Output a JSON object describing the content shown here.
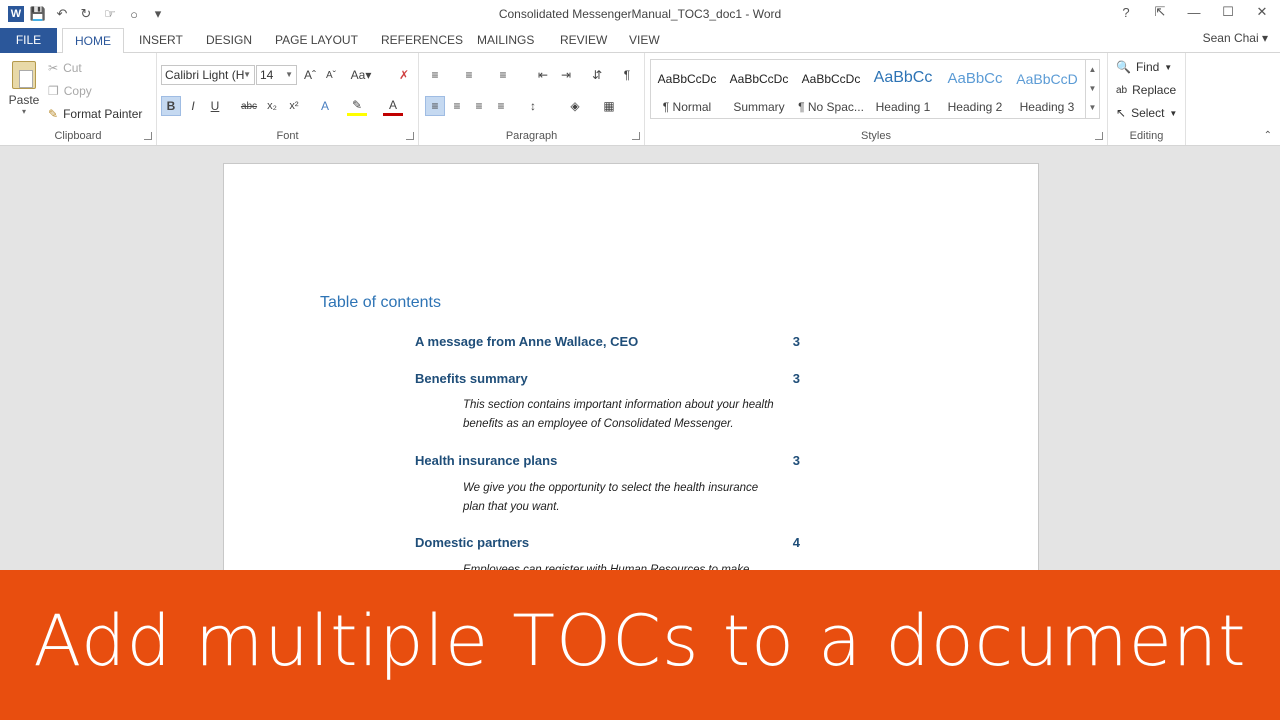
{
  "window": {
    "title": "Consolidated MessengerManual_TOC3_doc1 - Word",
    "help": "?",
    "user": "Sean Chai"
  },
  "tabs": [
    "FILE",
    "HOME",
    "INSERT",
    "DESIGN",
    "PAGE LAYOUT",
    "REFERENCES",
    "MAILINGS",
    "REVIEW",
    "VIEW"
  ],
  "clipboard": {
    "paste": "Paste",
    "cut": "Cut",
    "copy": "Copy",
    "format_painter": "Format Painter",
    "label": "Clipboard"
  },
  "font": {
    "name": "Calibri Light (H",
    "size": "14",
    "label": "Font"
  },
  "paragraph": {
    "label": "Paragraph"
  },
  "styles": {
    "label": "Styles",
    "items": [
      {
        "sample": "AaBbCcDc",
        "name": "¶ Normal"
      },
      {
        "sample": "AaBbCcDc",
        "name": "Summary"
      },
      {
        "sample": "AaBbCcDc",
        "name": "¶ No Spac..."
      },
      {
        "sample": "AaBbCc",
        "name": "Heading 1"
      },
      {
        "sample": "AaBbCc",
        "name": "Heading 2"
      },
      {
        "sample": "AaBbCcD",
        "name": "Heading 3"
      }
    ]
  },
  "editing": {
    "find": "Find",
    "replace": "Replace",
    "select": "Select",
    "label": "Editing"
  },
  "document": {
    "toc_title": "Table of contents",
    "entries": [
      {
        "title": "A message from Anne Wallace, CEO",
        "page": "3"
      },
      {
        "title": "Benefits summary",
        "page": "3",
        "desc1": "This section contains important information about your health",
        "desc2": "benefits as an employee of Consolidated Messenger."
      },
      {
        "title": "Health insurance plans",
        "page": "3",
        "desc1": "We give you the opportunity to select the health insurance",
        "desc2": "plan that you want."
      },
      {
        "title": "Domestic partners",
        "page": "4",
        "desc1": "Employees can register with Human Resources to make"
      }
    ]
  },
  "banner": {
    "text": "Add multiple TOCs to a document"
  },
  "colors": {
    "accent": "#2b579a",
    "banner": "#e84e0f",
    "heading": "#2e74b5"
  }
}
